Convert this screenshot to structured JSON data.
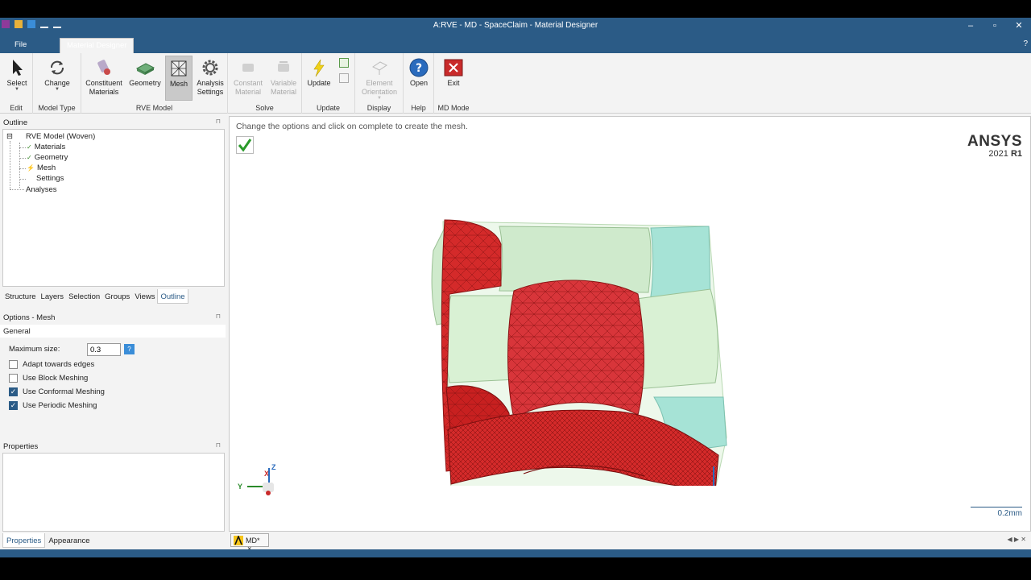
{
  "window": {
    "title": "A:RVE - MD - SpaceClaim - Material Designer"
  },
  "tabs": {
    "file": "File",
    "material_designer": "Material Designer"
  },
  "ribbon": {
    "groups": {
      "edit": "Edit",
      "model_type": "Model Type",
      "rve_model": "RVE Model",
      "solve": "Solve",
      "update": "Update",
      "display": "Display",
      "help": "Help",
      "md_mode": "MD Mode"
    },
    "buttons": {
      "select": "Select",
      "change": "Change",
      "constituent_1": "Constituent",
      "constituent_2": "Materials",
      "geometry": "Geometry",
      "mesh": "Mesh",
      "analysis_1": "Analysis",
      "analysis_2": "Settings",
      "constant_1": "Constant",
      "constant_2": "Material",
      "variable_1": "Variable",
      "variable_2": "Material",
      "update": "Update",
      "element_1": "Element",
      "element_2": "Orientation",
      "open": "Open",
      "exit": "Exit"
    }
  },
  "outline": {
    "header": "Outline",
    "root": "RVE Model (Woven)",
    "items": [
      "Materials",
      "Geometry",
      "Mesh",
      "Settings"
    ],
    "analyses": "Analyses",
    "tabs": [
      "Structure",
      "Layers",
      "Selection",
      "Groups",
      "Views",
      "Outline"
    ]
  },
  "options": {
    "header": "Options - Mesh",
    "section": "General",
    "max_size_label": "Maximum size:",
    "max_size_value": "0.3",
    "checkboxes": [
      {
        "label": "Adapt towards edges",
        "checked": false
      },
      {
        "label": "Use Block Meshing",
        "checked": false
      },
      {
        "label": "Use Conformal Meshing",
        "checked": true
      },
      {
        "label": "Use Periodic Meshing",
        "checked": true
      }
    ]
  },
  "properties": {
    "header": "Properties",
    "tabs": [
      "Properties",
      "Appearance"
    ]
  },
  "viewport": {
    "hint": "Change the options and click on complete to create the mesh.",
    "brand": "ANSYS",
    "version": "2021",
    "release": "R1",
    "scale": "0.2mm",
    "axis_z": "Z",
    "axis_y": "Y",
    "axis_x": "X"
  },
  "doc_tab": {
    "label": "MD*",
    "close": "×"
  },
  "colors": {
    "accent": "#2b5b86",
    "mesh_red": "#d42a2a",
    "matrix_green": "#cfeacc",
    "teal": "#a6e3d6"
  }
}
